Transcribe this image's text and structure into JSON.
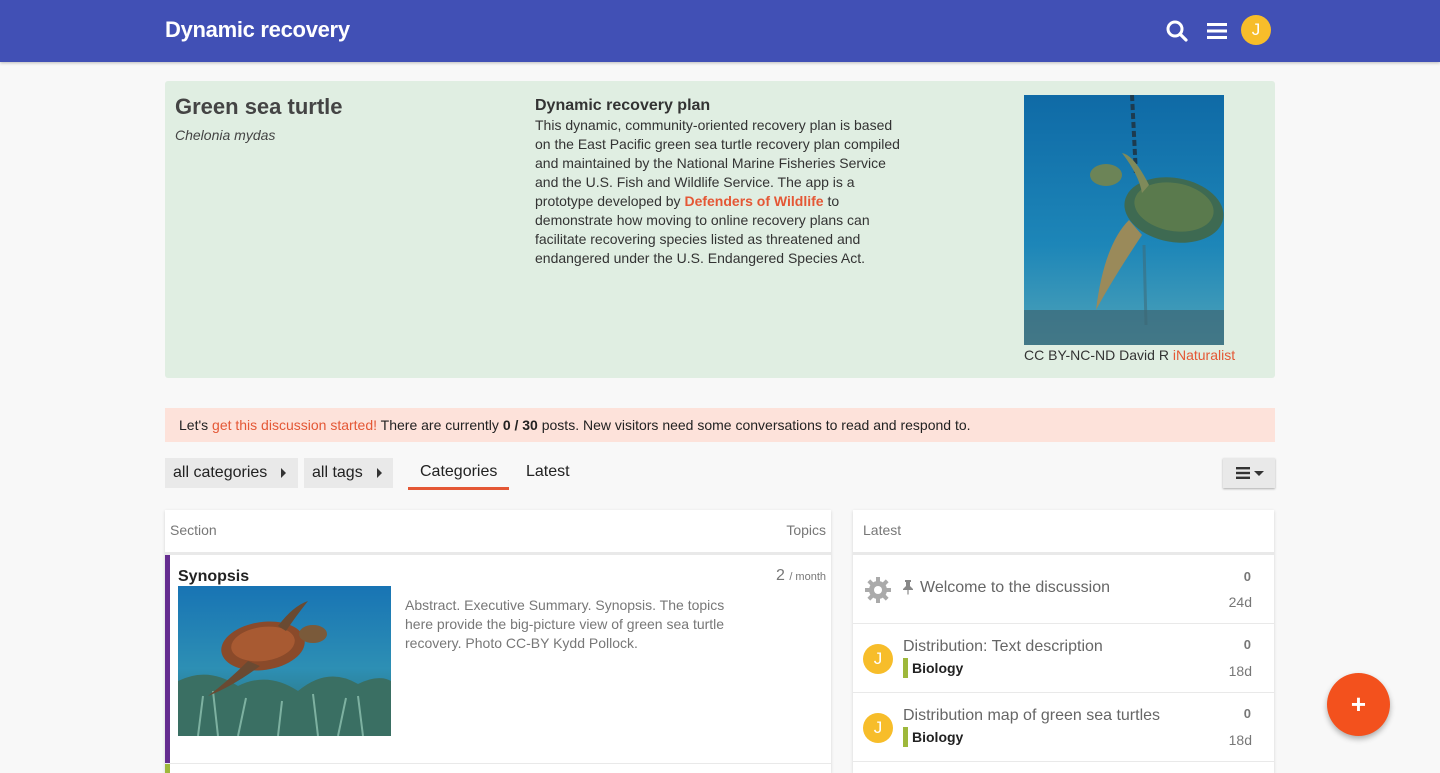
{
  "header": {
    "site_title": "Dynamic recovery",
    "avatar_letter": "J",
    "icons": [
      "search-icon",
      "hamburger-menu-icon"
    ]
  },
  "species": {
    "common_name": "Green sea turtle",
    "scientific_name": "Chelonia mydas",
    "plan_title": "Dynamic recovery plan",
    "plan_text_1": "This dynamic, community-oriented recovery plan is based on the East Pacific green sea turtle recovery plan compiled and maintained by the National Marine Fisheries Service and the U.S. Fish and Wildlife Service. The app is a prototype developed by ",
    "plan_link": "Defenders of Wildlife",
    "plan_text_2": " to demonstrate how moving to online recovery plans can facilitate recovering species listed as threatened and endangered under the U.S. Endangered Species Act.",
    "photo_credit": "CC BY-NC-ND David R",
    "photo_credit_link": "iNaturalist"
  },
  "alert": {
    "prefix": "Let's ",
    "link": "get this discussion started!",
    "middle": " There are currently ",
    "count": "0 / 30",
    "suffix": " posts. New visitors need some conversations to read and respond to."
  },
  "nav": {
    "categories_dropdown": "all categories",
    "tags_dropdown": "all tags",
    "tabs": [
      {
        "label": "Categories",
        "active": true
      },
      {
        "label": "Latest",
        "active": false
      }
    ]
  },
  "categories_table": {
    "col_section": "Section",
    "col_topics": "Topics",
    "rows": [
      {
        "name": "Synopsis",
        "color": "#652d90",
        "description": "Abstract. Executive Summary. Synopsis. The topics here provide the big-picture view of green sea turtle recovery. Photo CC-BY Kydd Pollock.",
        "topics_count": "2",
        "topics_unit": "/ month"
      }
    ]
  },
  "latest": {
    "heading": "Latest",
    "items": [
      {
        "title": "Welcome to the discussion",
        "posts": "0",
        "age": "24d",
        "pinned": true
      },
      {
        "title": "Distribution: Text description",
        "category": "Biology",
        "category_color": "#9eb83b",
        "posts": "0",
        "age": "18d",
        "avatar_letter": "J"
      },
      {
        "title": "Distribution map of green sea turtles",
        "category": "Biology",
        "category_color": "#9eb83b",
        "posts": "0",
        "age": "18d",
        "avatar_letter": "J"
      }
    ]
  },
  "fab_label": "+"
}
